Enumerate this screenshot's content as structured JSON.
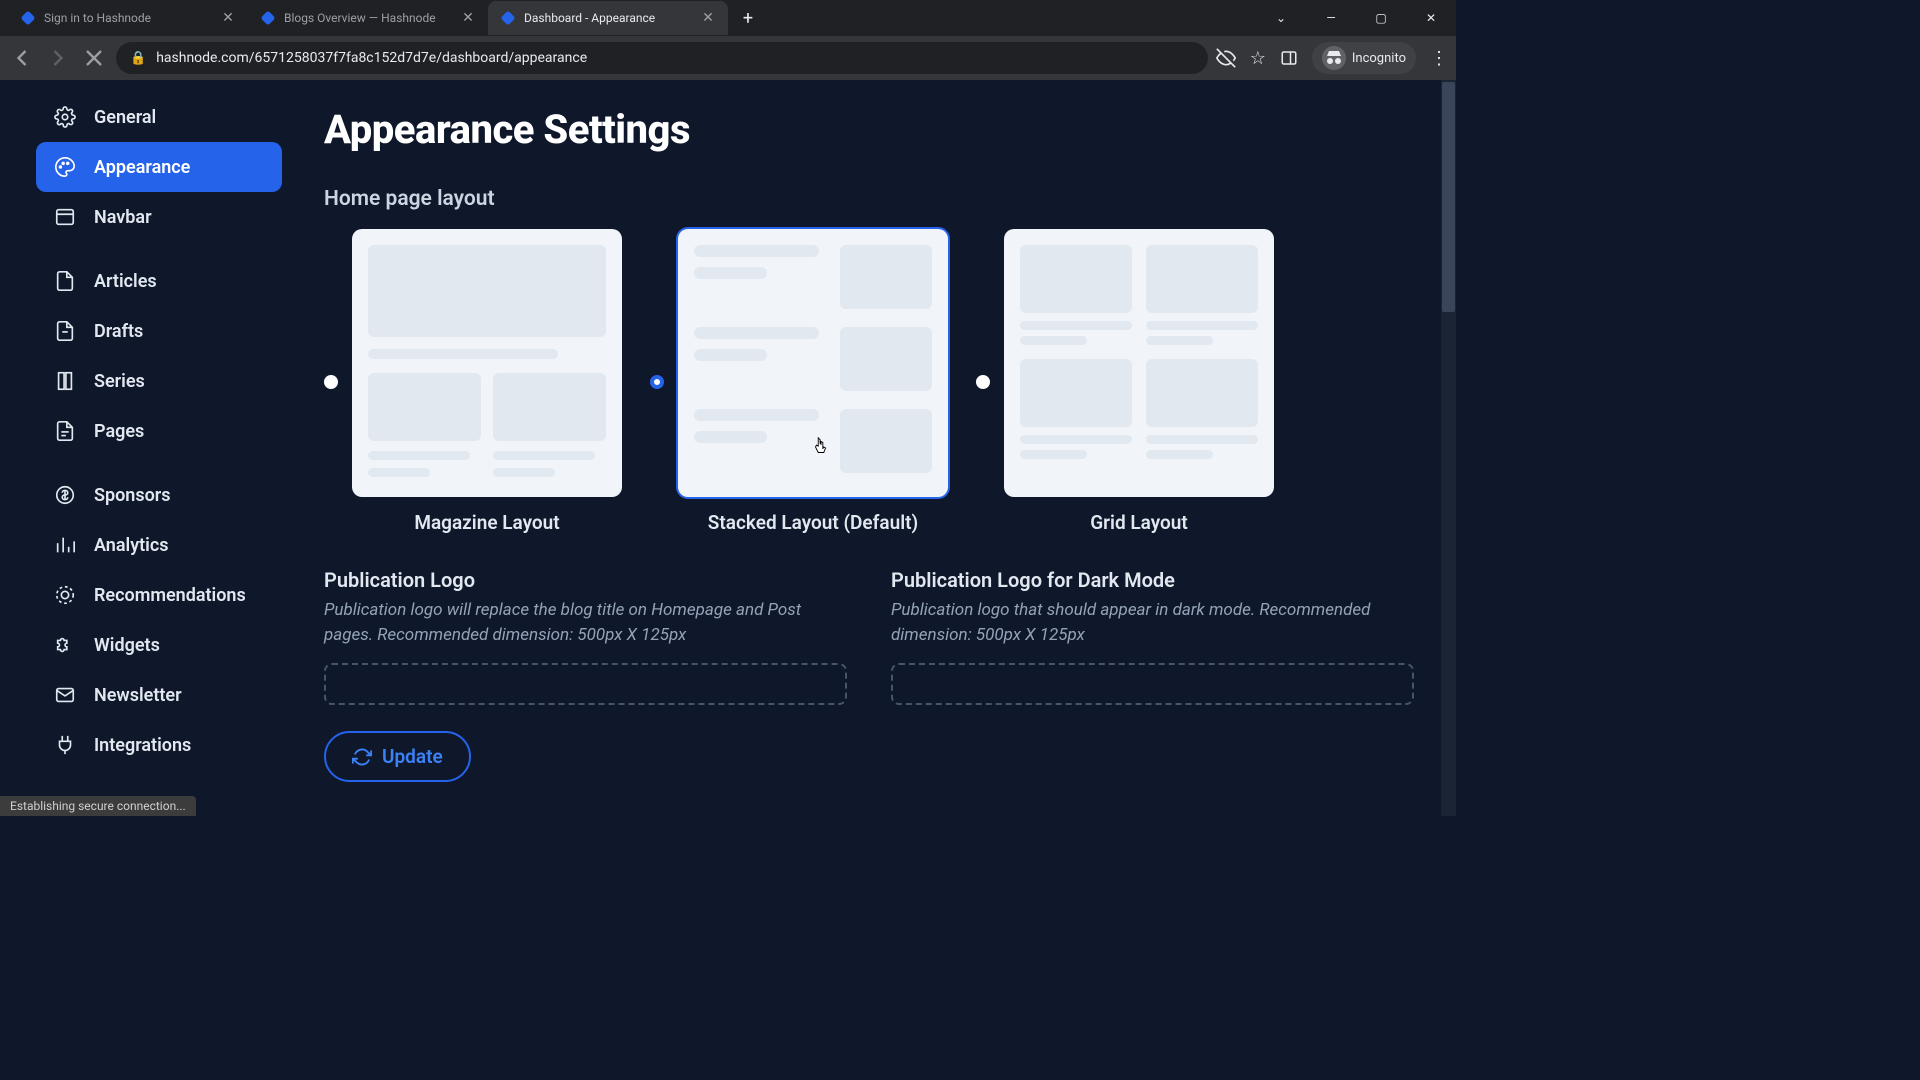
{
  "browser": {
    "tabs": [
      {
        "title": "Sign in to Hashnode",
        "active": false
      },
      {
        "title": "Blogs Overview — Hashnode",
        "active": false
      },
      {
        "title": "Dashboard - Appearance",
        "active": true
      }
    ],
    "url": "hashnode.com/6571258037f7fa8c152d7d7e/dashboard/appearance",
    "incognito_label": "Incognito"
  },
  "sidebar": {
    "group1": [
      {
        "label": "General",
        "icon": "gear"
      },
      {
        "label": "Appearance",
        "icon": "palette",
        "active": true
      },
      {
        "label": "Navbar",
        "icon": "navbar"
      }
    ],
    "group2": [
      {
        "label": "Articles",
        "icon": "doc"
      },
      {
        "label": "Drafts",
        "icon": "file"
      },
      {
        "label": "Series",
        "icon": "stack"
      },
      {
        "label": "Pages",
        "icon": "page"
      }
    ],
    "group3": [
      {
        "label": "Sponsors",
        "icon": "dollar"
      },
      {
        "label": "Analytics",
        "icon": "chart"
      },
      {
        "label": "Recommendations",
        "icon": "target"
      },
      {
        "label": "Widgets",
        "icon": "puzzle"
      },
      {
        "label": "Newsletter",
        "icon": "mail"
      },
      {
        "label": "Integrations",
        "icon": "plug"
      }
    ]
  },
  "page": {
    "title": "Appearance Settings",
    "section_layout": "Home page layout",
    "layouts": [
      {
        "label": "Magazine Layout",
        "selected": false
      },
      {
        "label": "Stacked Layout (Default)",
        "selected": true
      },
      {
        "label": "Grid Layout",
        "selected": false
      }
    ],
    "logo": {
      "light_title": "Publication Logo",
      "light_desc": "Publication logo will replace the blog title on Homepage and Post pages. Recommended dimension: 500px X 125px",
      "dark_title": "Publication Logo for Dark Mode",
      "dark_desc": "Publication logo that should appear in dark mode. Recommended dimension: 500px X 125px"
    },
    "update_label": "Update"
  },
  "status_bar": "Establishing secure connection..."
}
